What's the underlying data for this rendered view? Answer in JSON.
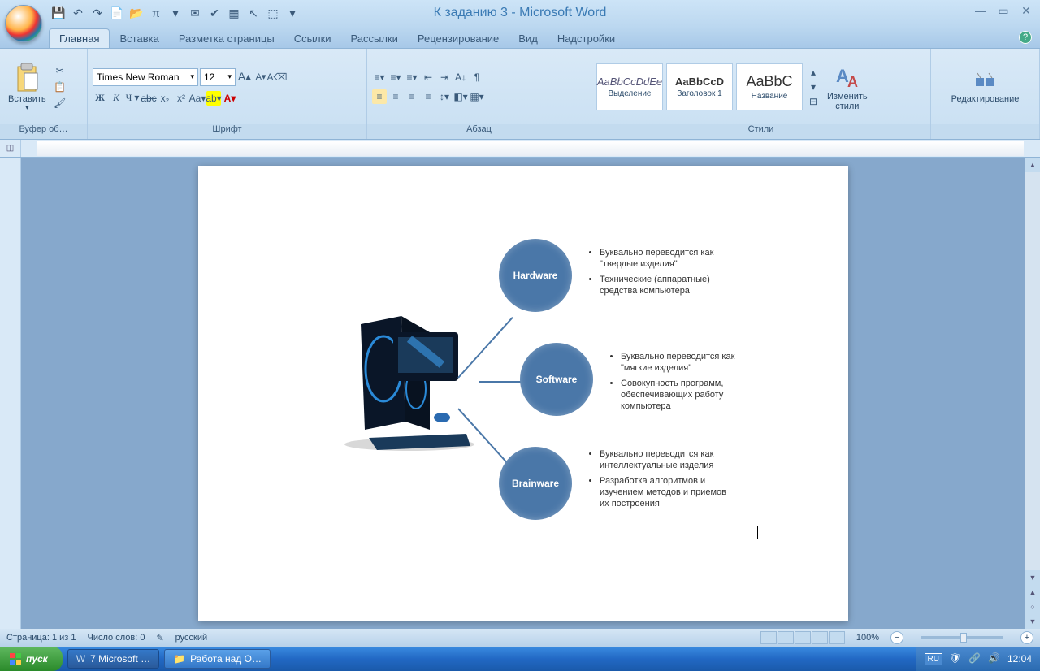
{
  "title": "К заданию 3 - Microsoft Word",
  "tabs": [
    "Главная",
    "Вставка",
    "Разметка страницы",
    "Ссылки",
    "Рассылки",
    "Рецензирование",
    "Вид",
    "Надстройки"
  ],
  "active_tab": 0,
  "ribbon": {
    "clipboard": {
      "paste": "Вставить",
      "label": "Буфер об…"
    },
    "font": {
      "label": "Шрифт",
      "family": "Times New Roman",
      "size": "12"
    },
    "paragraph": {
      "label": "Абзац"
    },
    "styles": {
      "label": "Стили",
      "items": [
        {
          "preview": "AaBbCcDdEe",
          "name": "Выделение",
          "italic": true
        },
        {
          "preview": "AaBbCcD",
          "name": "Заголовок 1",
          "italic": false
        },
        {
          "preview": "AaBbC",
          "name": "Название",
          "italic": false
        }
      ],
      "change": "Изменить\nстили"
    },
    "editing": {
      "label": "Редактирование"
    }
  },
  "doc": {
    "bubbles": [
      {
        "title": "Hardware",
        "bullets": [
          "Буквально переводится как \"твердые изделия\"",
          "Технические (аппаратные) средства компьютера"
        ]
      },
      {
        "title": "Software",
        "bullets": [
          "Буквально переводится как \"мягкие изделия\"",
          "Совокупность программ, обеспечивающих работу компьютера"
        ]
      },
      {
        "title": "Brainware",
        "bullets": [
          "Буквально переводится как интеллектуальные изделия",
          "Разработка алгоритмов и изучением методов и приемов их построения"
        ]
      }
    ]
  },
  "status": {
    "page": "Страница: 1 из 1",
    "words": "Число слов: 0",
    "lang": "русский",
    "zoom": "100%"
  },
  "taskbar": {
    "start": "пуск",
    "items": [
      {
        "label": "7 Microsoft …",
        "active": true
      },
      {
        "label": "Работа над О…",
        "active": false
      }
    ],
    "lang": "RU",
    "time": "12:04"
  }
}
